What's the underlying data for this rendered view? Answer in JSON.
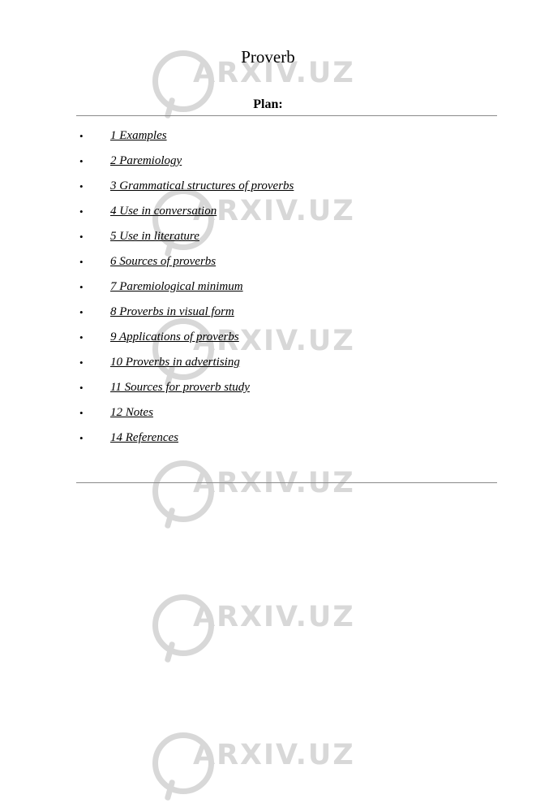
{
  "document": {
    "title": "Proverb",
    "plan_heading": "Plan:",
    "bullet_glyph": "•",
    "toc": [
      {
        "label": "1 Examples"
      },
      {
        "label": "2 Paremiology"
      },
      {
        "label": "3 Grammatical structures of proverbs"
      },
      {
        "label": "4 Use in conversation"
      },
      {
        "label": "5 Use in literature"
      },
      {
        "label": "6 Sources of proverbs"
      },
      {
        "label": "7 Paremiological minimum"
      },
      {
        "label": "8 Proverbs in visual form"
      },
      {
        "label": "9 Applications of proverbs"
      },
      {
        "label": "10 Proverbs in advertising"
      },
      {
        "label": "11 Sources for proverb study"
      },
      {
        "label": "12 Notes"
      },
      {
        "label": "14 References"
      }
    ]
  },
  "watermark": {
    "text": "ARXIV.UZ",
    "color": "#d8d8d8",
    "positions": [
      40,
      210,
      370,
      545,
      710,
      880
    ]
  }
}
